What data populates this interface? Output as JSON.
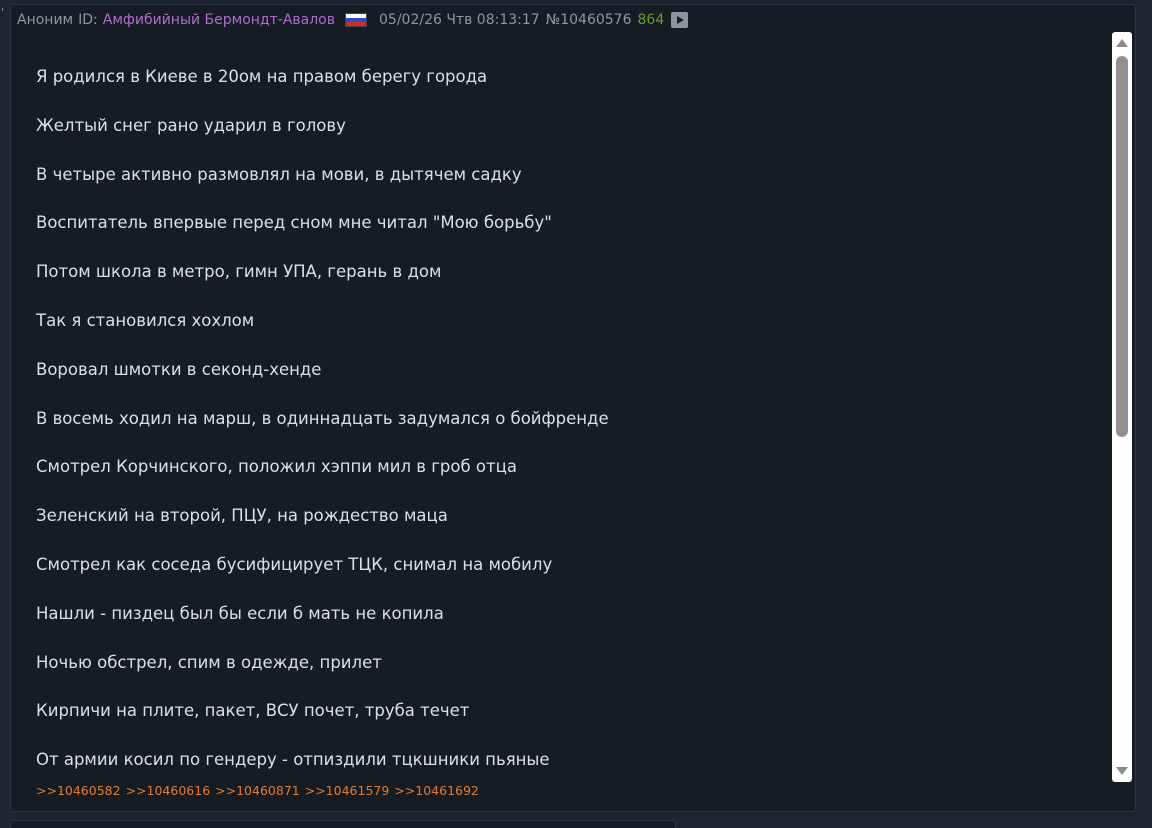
{
  "post": {
    "poster_name": "Аноним",
    "id_label": "ID:",
    "poster_id": "Амфибийный Бермондт-Авалов",
    "flag_icon": "russia-flag-icon",
    "date": "05/02/26 Чтв 08:13:17",
    "number": "№10460576",
    "count": "864",
    "play_icon": "play-icon",
    "corner_mark": "'"
  },
  "message": {
    "lines": [
      "Я родился в Киеве в 20ом на правом берегу города",
      "Желтый снег рано ударил в голову",
      "В четыре активно размовлял на мови, в дытячем садку",
      "Воспитатель впервые перед сном мне читал \"Мою борьбу\"",
      "Потом школа в метро, гимн УПА, герань в дом",
      "Так я становился хохлом",
      "Воровал шмотки в секонд-хенде",
      "В восемь ходил на марш, в одиннадцать задумался о бойфренде",
      "Смотрел Корчинского, положил хэппи мил в гроб отца",
      "Зеленский на второй, ПЦУ, на рождество маца",
      "Смотрел как соседа бусифицирует ТЦК, снимал на мобилу",
      "Нашли - пиздец был бы если б мать не копила",
      "Ночью обстрел, спим в одежде, прилет",
      "Кирпичи на плите, пакет, ВСУ почет, труба течет",
      "От армии косил по гендеру - отпиздили тцкшники пьяные"
    ]
  },
  "replies": [
    ">>10460582",
    ">>10460616",
    ">>10460871",
    ">>10461579",
    ">>10461692"
  ],
  "colors": {
    "background": "#1c2530",
    "post_background": "#151c24",
    "poster_id": "#b16bd0",
    "count": "#6d9a27",
    "reply_link": "#e37b2f",
    "text": "#dbe0e5",
    "meta": "#8e979f"
  }
}
